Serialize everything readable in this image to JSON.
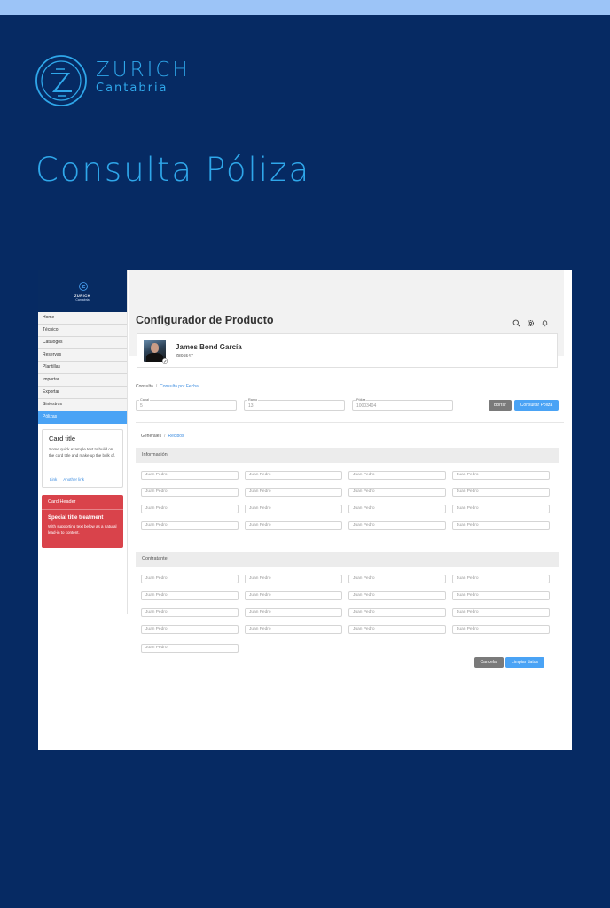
{
  "brand": {
    "name": "ZURICH",
    "subtitle": "Cantabria"
  },
  "hero_title": "Consulta Póliza",
  "sidebar": {
    "logo_name": "ZURICH",
    "logo_sub": "Cantabria",
    "items": [
      {
        "label": "Home"
      },
      {
        "label": "Técnico"
      },
      {
        "label": "Catálogos"
      },
      {
        "label": "Reservas"
      },
      {
        "label": "Plantillas"
      },
      {
        "label": "Importar"
      },
      {
        "label": "Exportar"
      },
      {
        "label": "Siniestros"
      },
      {
        "label": "Pólizas",
        "active": true
      }
    ],
    "card": {
      "title": "Card title",
      "text": "Some quick example text to build on the card title and make up the bulk of.",
      "link1": "Link",
      "link2": "Another link"
    },
    "alert_card": {
      "header": "Card Header",
      "title": "Special title treatment",
      "text": "With supporting text below as a natural lead-in to content."
    }
  },
  "header": {
    "title": "Configurador de Producto",
    "icons": [
      "search-icon",
      "gear-icon",
      "bell-icon"
    ]
  },
  "user": {
    "name": "James Bond García",
    "id": "Z895547"
  },
  "breadcrumb": {
    "root": "Consulta",
    "current": "Consulta por Fecha"
  },
  "search": {
    "fields": [
      {
        "label": "Canal",
        "value": "5"
      },
      {
        "label": "Ramo",
        "value": "13"
      },
      {
        "label": "Póliza",
        "value": "10003404"
      }
    ],
    "clear_label": "Borrar",
    "submit_label": "Consultar Póliza"
  },
  "tabs": {
    "root": "Generales",
    "current": "Recibos"
  },
  "sections": {
    "informacion": {
      "title": "Información",
      "value": "Juan Pedro"
    },
    "contratante": {
      "title": "Contratante",
      "value": "Juan Pedro"
    }
  },
  "actions": {
    "cancel_label": "Cancelar",
    "clear_label": "Limpiar datos"
  },
  "colors": {
    "background": "#062a63",
    "accent": "#2fa7ea",
    "primary_button": "#4aa3f5",
    "danger": "#d9434b"
  }
}
